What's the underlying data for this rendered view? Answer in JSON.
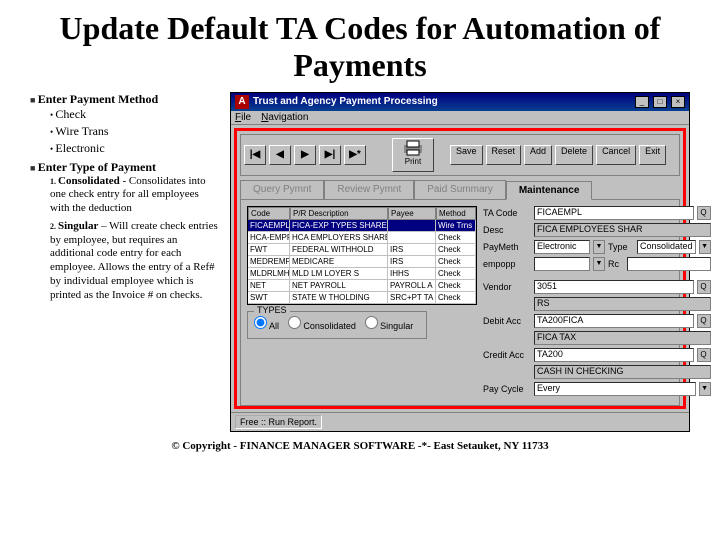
{
  "slide": {
    "title": "Update Default TA Codes for Automation of Payments",
    "bullet1": "Enter Payment Method",
    "sub1": [
      "Check",
      "Wire Trans",
      "Electronic"
    ],
    "bullet2": "Enter Type of Payment",
    "num1_label": "1.",
    "num1_title": "Consolidated",
    "num1_text": " - Consolidates into one check entry for all employees with the deduction",
    "num2_label": "2.",
    "num2_title": "Singular",
    "num2_text": " – Will create check entries by employee, but requires an additional code entry for each employee. Allows the entry of a Ref# by individual employee which is printed as the Invoice # on checks.",
    "copyright": "© Copyright - FINANCE MANAGER SOFTWARE -*- East Setauket, NY 11733"
  },
  "app": {
    "icon": "A",
    "title": "Trust and Agency Payment Processing",
    "menus": [
      "File",
      "Navigation"
    ],
    "nav": [
      "|◀",
      "◀",
      "▶",
      "▶|",
      "▶*"
    ],
    "print": "Print",
    "actions": [
      "Save",
      "Reset",
      "Add",
      "Delete",
      "Cancel",
      "Exit"
    ],
    "tabs": [
      "Query Pymnt",
      "Review Pymnt",
      "Paid Summary",
      "Maintenance"
    ],
    "active_tab": 3,
    "grid": {
      "headers": [
        "Code",
        "P/R Description",
        "Payee",
        "Method"
      ],
      "rows": [
        {
          "code": "FICAEMPL",
          "desc": "FICA-EXP TYPES SHARES",
          "payee": "",
          "method": "Wire Trns",
          "sel": true
        },
        {
          "code": "HCA-EMPR",
          "desc": "HCA EMPLOYERS SHARES",
          "payee": "",
          "method": "Check",
          "c": "C"
        },
        {
          "code": "FWT",
          "desc": "FEDERAL WITHHOLD",
          "payee": "IRS",
          "method": "Check",
          "c": "C"
        },
        {
          "code": "MEDREMPL",
          "desc": "MEDICARE",
          "payee": "IRS",
          "method": "Check",
          "c": "C"
        },
        {
          "code": "MLDRLMHL",
          "desc": "MLD LM LOYER S",
          "payee": "IHHS",
          "method": "Check",
          "c": "C"
        },
        {
          "code": "NET",
          "desc": "NET PAYROLL",
          "payee": "PAYROLL A",
          "method": "Check",
          "c": "C"
        },
        {
          "code": "SWT",
          "desc": "STATE W THOLDING",
          "payee": "SRC+PT TA",
          "method": "Check",
          "c": "C"
        }
      ]
    },
    "form": {
      "ta_code_label": "TA Code",
      "ta_code": "FICAEMPL",
      "desc_label": "Desc",
      "desc": "FICA EMPLOYEES SHAR",
      "paymeth_label": "PayMeth",
      "paymeth": "Electronic",
      "type_label": "Type",
      "type": "Consolidated",
      "empopp_label": "empopp",
      "empopp": "",
      "rc_label": "Rc",
      "vendor_label": "Vendor",
      "vendor": "3051",
      "vendor_name": "RS",
      "debit_label": "Debit Acc",
      "debit": "TA200FICA",
      "debit_name": "FICA TAX",
      "credit_label": "Credit Acc",
      "credit": "TA200",
      "credit_name": "CASH IN CHECKING",
      "paycycle_label": "Pay Cycle",
      "paycycle": "Every"
    },
    "types": {
      "legend": "TYPES",
      "opts": [
        "All",
        "Consolidated",
        "Singular"
      ],
      "selected": 0
    },
    "status": "Free :: Run Report."
  }
}
